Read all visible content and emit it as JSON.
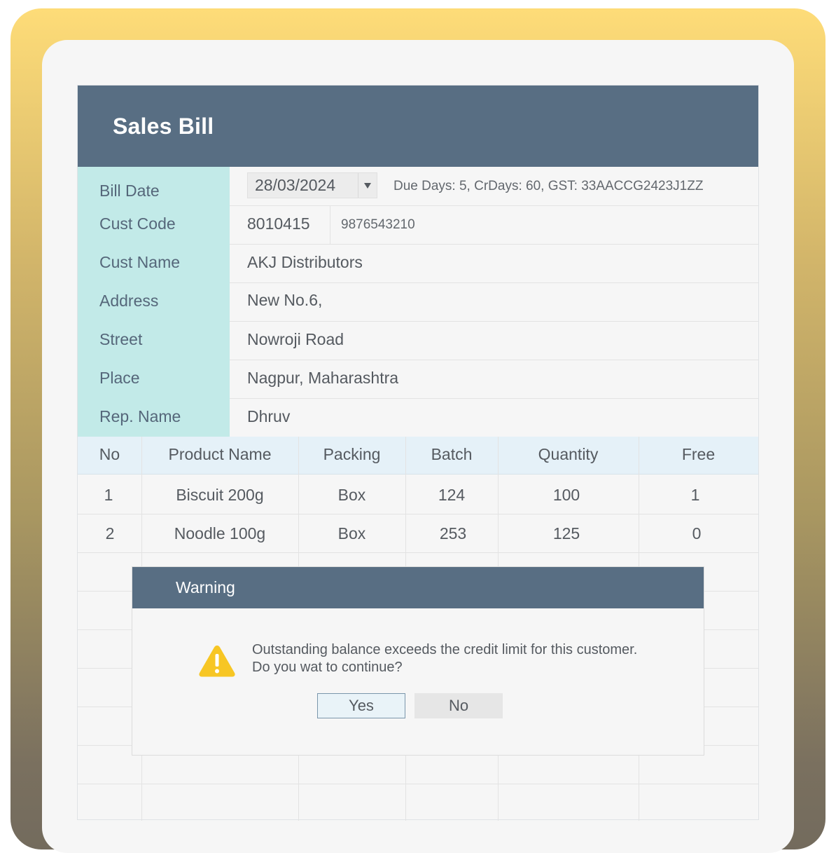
{
  "window": {
    "title": "Sales Bill"
  },
  "form": {
    "labels": {
      "bill_date": "Bill Date",
      "cust_code": "Cust Code",
      "cust_name": "Cust Name",
      "address": "Address",
      "street": "Street",
      "place": "Place",
      "rep_name": "Rep. Name"
    },
    "bill_date": "28/03/2024",
    "due_info": "Due Days: 5, CrDays: 60, GST: 33AACCG2423J1ZZ",
    "cust_code": "8010415",
    "phone": "9876543210",
    "cust_name": "AKJ Distributors",
    "address": "New No.6,",
    "street": "Nowroji Road",
    "place": "Nagpur, Maharashtra",
    "rep_name": "Dhruv"
  },
  "table": {
    "headers": [
      "No",
      "Product Name",
      "Packing",
      "Batch",
      "Quantity",
      "Free"
    ],
    "rows": [
      [
        "1",
        "Biscuit 200g",
        "Box",
        "124",
        "100",
        "1"
      ],
      [
        "2",
        "Noodle 100g",
        "Box",
        "253",
        "125",
        "0"
      ]
    ]
  },
  "dialog": {
    "title": "Warning",
    "message": "Outstanding balance exceeds the credit limit for this customer. Do you wat to continue?",
    "yes_label": "Yes",
    "no_label": "No",
    "icon": "warning-triangle-icon",
    "icon_color": "#f7c624"
  },
  "colors": {
    "title_bar": "#586e83",
    "label_column": "#c2eae8",
    "table_header": "#e5f1f8",
    "frame_top": "#fedc78",
    "frame_bottom": "#736b5d"
  }
}
